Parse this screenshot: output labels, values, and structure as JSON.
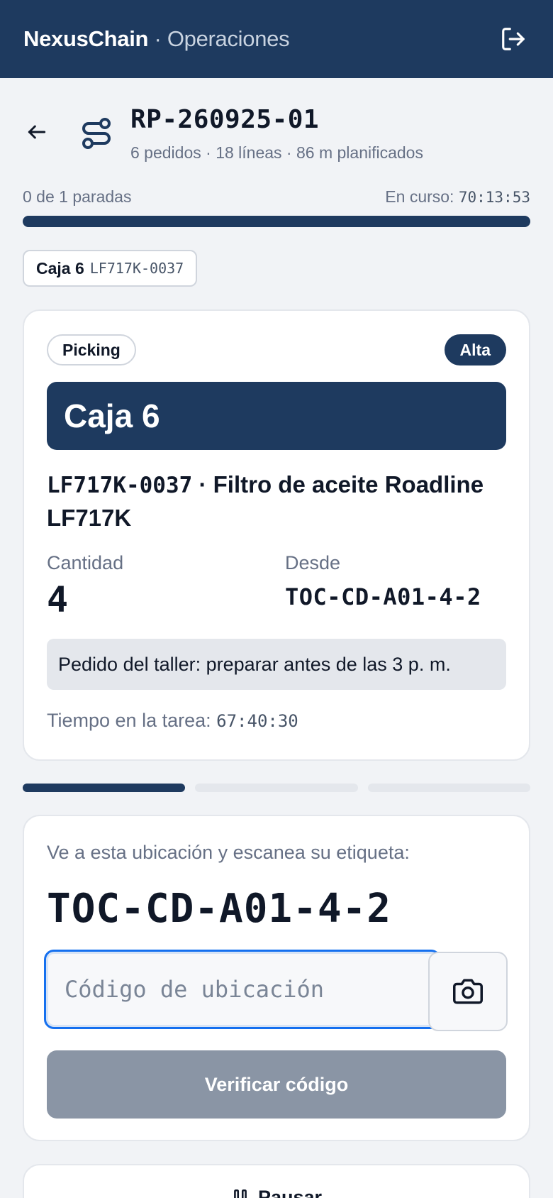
{
  "header": {
    "brand_name": "NexusChain",
    "brand_separator": " · ",
    "brand_section": "Operaciones",
    "logout_icon": "logout-icon"
  },
  "route": {
    "code": "RP-260925-01",
    "meta": "6 pedidos · 18 líneas · 86 m planificados",
    "back_icon": "arrow-left-icon",
    "route_icon": "route-icon"
  },
  "progress": {
    "stops_label": "0 de 1 paradas",
    "elapsed_label": "En curso:",
    "elapsed_time": "70:13:53",
    "fraction": 0
  },
  "box_chip": {
    "label": "Caja 6",
    "code": "LF717K-0037"
  },
  "task": {
    "status": "Picking",
    "priority": "Alta",
    "box_title": "Caja 6",
    "product_code": "LF717K-0037",
    "product_name": " · Filtro de aceite Roadline LF717K",
    "quantity_label": "Cantidad",
    "quantity_value": "4",
    "from_label": "Desde",
    "from_value": "TOC-CD-A01-4-2",
    "note": "Pedido del taller: preparar antes de las 3 p. m.",
    "time_label": "Tiempo en la tarea:",
    "time_value": "67:40:30"
  },
  "steps": {
    "total": 3,
    "current": 1
  },
  "scan": {
    "instruction": "Ve a esta ubicación y escanea su etiqueta:",
    "location": "TOC-CD-A01-4-2",
    "input_value": "",
    "input_placeholder": "Código de ubicación",
    "camera_icon": "camera-icon",
    "verify_label": "Verificar código"
  },
  "pause": {
    "label": "Pausar",
    "icon": "pause-icon"
  },
  "colors": {
    "primary": "#1e3a5f",
    "focus": "#1570ef",
    "disabled_button": "#8a95a5",
    "page_bg": "#f1f3f6"
  }
}
